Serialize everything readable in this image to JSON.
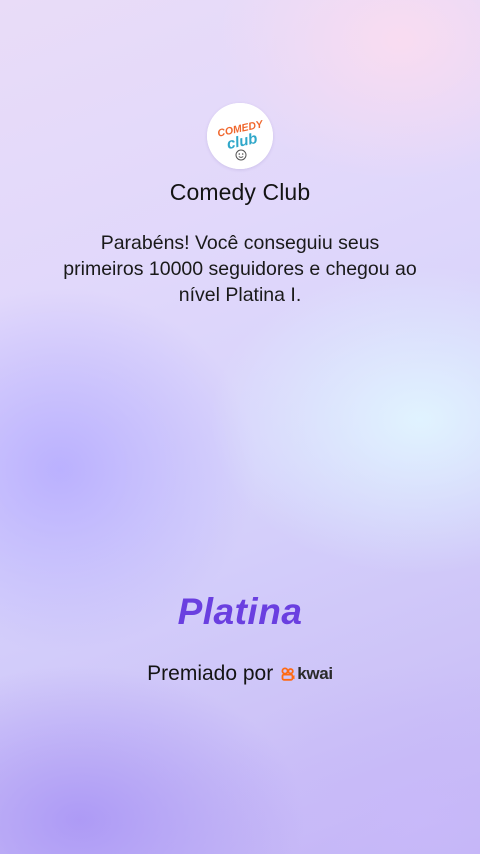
{
  "profile": {
    "logo_text_top": "COMEDY",
    "logo_text_bottom": "club",
    "name": "Comedy Club"
  },
  "message": "Parabéns! Você conseguiu seus primeiros 10000 seguidores e chegou ao nível Platina I.",
  "level": {
    "name": "Platina",
    "color": "#6a3fe0"
  },
  "awarded_by": {
    "label": "Premiado por",
    "brand": "kwai",
    "brand_color": "#ff6a13"
  }
}
